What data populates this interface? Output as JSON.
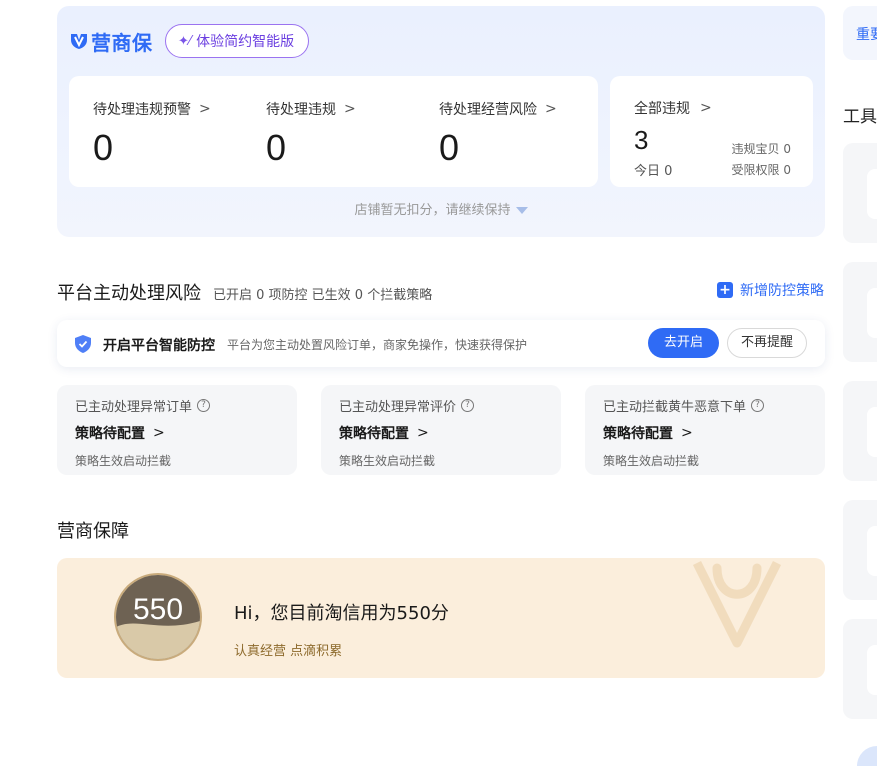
{
  "header": {
    "brand": "营商保",
    "smart_button": "体验简约智能版"
  },
  "pending": [
    {
      "label": "待处理违规预警",
      "value": "0"
    },
    {
      "label": "待处理违规",
      "value": "0"
    },
    {
      "label": "待处理经营风险",
      "value": "0"
    }
  ],
  "all_violations": {
    "label": "全部违规",
    "value": "3",
    "today": "今日 0",
    "item_violation": "违规宝贝 0",
    "restricted": "受限权限 0"
  },
  "status_tip": "店铺暂无扣分，请继续保持",
  "right_panel": {
    "top_text": "重要",
    "tools_title": "工具"
  },
  "platform_risk": {
    "title": "平台主动处理风险",
    "summary": "已开启 0 项防控 已生效 0 个拦截策略",
    "add_button": "新增防控策略",
    "smart_guard": {
      "title": "开启平台智能防控",
      "desc": "平台为您主动处置风险订单，商家免操作，快速获得保护",
      "open_button": "去开启",
      "dismiss_button": "不再提醒"
    },
    "cards": [
      {
        "title": "已主动处理异常订单",
        "status": "策略待配置",
        "note": "策略生效启动拦截"
      },
      {
        "title": "已主动处理异常评价",
        "status": "策略待配置",
        "note": "策略生效启动拦截"
      },
      {
        "title": "已主动拦截黄牛恶意下单",
        "status": "策略待配置",
        "note": "策略生效启动拦截"
      }
    ]
  },
  "guarantee": {
    "title": "营商保障",
    "score": "550",
    "greeting": "Hi，您目前淘信用为550分",
    "slogan": "认真经营 点滴积累"
  },
  "colors": {
    "primary": "#2f6bf5",
    "accent_purple": "#6b3fe0",
    "credit_bg": "#fbeedc"
  }
}
